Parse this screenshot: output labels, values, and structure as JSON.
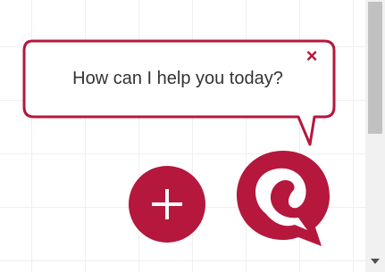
{
  "colors": {
    "accent": "#b5173d",
    "bubble_bg": "#ffffff",
    "text": "#333333",
    "scrollbar_track": "#f1f1f1",
    "scrollbar_thumb": "#c1c1c1"
  },
  "greeting": {
    "message": "How can I help you today?",
    "close_icon": "close-icon",
    "close_glyph": "×"
  },
  "actions": {
    "add_icon": "plus-icon",
    "launcher_icon": "chat-logo-icon"
  },
  "scrollbar": {
    "down_arrow_icon": "chevron-down-icon"
  }
}
